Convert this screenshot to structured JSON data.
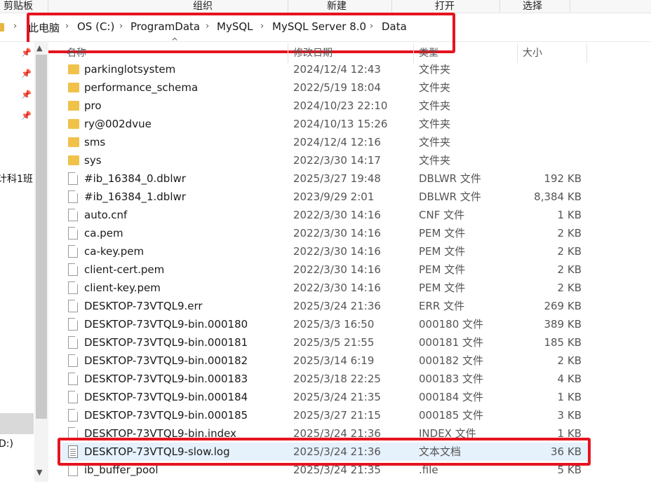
{
  "ribbon": {
    "groups": [
      "剪贴板",
      "组织",
      "新建",
      "打开",
      "选择"
    ]
  },
  "address": {
    "crumbs": [
      "此电脑",
      "OS (C:)",
      "ProgramData",
      "MySQL",
      "MySQL Server 8.0",
      "Data"
    ],
    "separator": "›"
  },
  "nav": {
    "partial_labels": [
      "计科1班",
      "D:)"
    ]
  },
  "columns": {
    "name": "名称",
    "date": "修改日期",
    "type": "类型",
    "size": "大小"
  },
  "files": [
    {
      "name": "parkinglotsystem",
      "date": "2024/12/4 12:43",
      "type": "文件夹",
      "size": "",
      "icon": "folder-icon"
    },
    {
      "name": "performance_schema",
      "date": "2022/5/19 18:04",
      "type": "文件夹",
      "size": "",
      "icon": "folder-icon"
    },
    {
      "name": "pro",
      "date": "2024/10/23 22:10",
      "type": "文件夹",
      "size": "",
      "icon": "folder-icon"
    },
    {
      "name": "ry@002dvue",
      "date": "2024/10/13 15:26",
      "type": "文件夹",
      "size": "",
      "icon": "folder-icon"
    },
    {
      "name": "sms",
      "date": "2024/12/4 12:16",
      "type": "文件夹",
      "size": "",
      "icon": "folder-icon"
    },
    {
      "name": "sys",
      "date": "2022/3/30 14:17",
      "type": "文件夹",
      "size": "",
      "icon": "folder-icon"
    },
    {
      "name": "#ib_16384_0.dblwr",
      "date": "2025/3/27 19:48",
      "type": "DBLWR 文件",
      "size": "192 KB",
      "icon": "file-icon"
    },
    {
      "name": "#ib_16384_1.dblwr",
      "date": "2023/9/29 2:01",
      "type": "DBLWR 文件",
      "size": "8,384 KB",
      "icon": "file-icon"
    },
    {
      "name": "auto.cnf",
      "date": "2022/3/30 14:16",
      "type": "CNF 文件",
      "size": "1 KB",
      "icon": "file-icon"
    },
    {
      "name": "ca.pem",
      "date": "2022/3/30 14:16",
      "type": "PEM 文件",
      "size": "2 KB",
      "icon": "file-icon"
    },
    {
      "name": "ca-key.pem",
      "date": "2022/3/30 14:16",
      "type": "PEM 文件",
      "size": "2 KB",
      "icon": "file-icon"
    },
    {
      "name": "client-cert.pem",
      "date": "2022/3/30 14:16",
      "type": "PEM 文件",
      "size": "2 KB",
      "icon": "file-icon"
    },
    {
      "name": "client-key.pem",
      "date": "2022/3/30 14:16",
      "type": "PEM 文件",
      "size": "2 KB",
      "icon": "file-icon"
    },
    {
      "name": "DESKTOP-73VTQL9.err",
      "date": "2025/3/24 21:36",
      "type": "ERR 文件",
      "size": "269 KB",
      "icon": "file-icon"
    },
    {
      "name": "DESKTOP-73VTQL9-bin.000180",
      "date": "2025/3/3 16:50",
      "type": "000180 文件",
      "size": "389 KB",
      "icon": "file-icon"
    },
    {
      "name": "DESKTOP-73VTQL9-bin.000181",
      "date": "2025/3/5 21:55",
      "type": "000181 文件",
      "size": "185 KB",
      "icon": "file-icon"
    },
    {
      "name": "DESKTOP-73VTQL9-bin.000182",
      "date": "2025/3/14 6:19",
      "type": "000182 文件",
      "size": "2 KB",
      "icon": "file-icon"
    },
    {
      "name": "DESKTOP-73VTQL9-bin.000183",
      "date": "2025/3/18 22:25",
      "type": "000183 文件",
      "size": "4 KB",
      "icon": "file-icon"
    },
    {
      "name": "DESKTOP-73VTQL9-bin.000184",
      "date": "2025/3/24 21:35",
      "type": "000184 文件",
      "size": "1 KB",
      "icon": "file-icon"
    },
    {
      "name": "DESKTOP-73VTQL9-bin.000185",
      "date": "2025/3/27 21:15",
      "type": "000185 文件",
      "size": "3 KB",
      "icon": "file-icon"
    },
    {
      "name": "DESKTOP-73VTQL9-bin.index",
      "date": "2025/3/24 21:36",
      "type": "INDEX 文件",
      "size": "1 KB",
      "icon": "file-icon"
    },
    {
      "name": "DESKTOP-73VTQL9-slow.log",
      "date": "2025/3/24 21:36",
      "type": "文本文档",
      "size": "36 KB",
      "icon": "text-document-icon",
      "selected": true
    },
    {
      "name": "ib_buffer_pool",
      "date": "2025/3/24 21:35",
      "type": ".file",
      "size": "5 KB",
      "icon": "file-icon"
    }
  ],
  "colors": {
    "highlight_box": "#e5141f",
    "selected_row": "#e5f1fb",
    "folder": "#f0c24a"
  }
}
